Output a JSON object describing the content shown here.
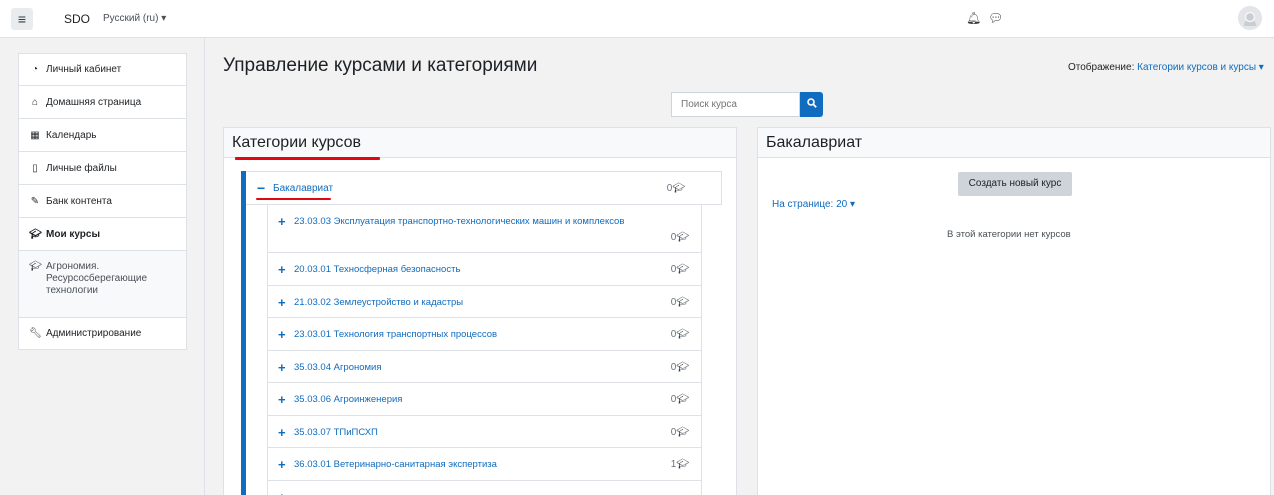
{
  "navbar": {
    "menu_icon": "hamburger-icon",
    "brand": "SDO",
    "language": "Русский (ru) ▾",
    "icons": [
      "bell-icon",
      "chat-icon",
      "avatar-icon"
    ]
  },
  "sidebar": {
    "items": [
      {
        "icon": "dashboard-icon",
        "label": "Личный кабинет"
      },
      {
        "icon": "home-icon",
        "label": "Домашняя страница"
      },
      {
        "icon": "calendar-icon",
        "label": "Календарь"
      },
      {
        "icon": "file-icon",
        "label": "Личные файлы"
      },
      {
        "icon": "paintbrush-icon",
        "label": "Банк контента"
      },
      {
        "icon": "graduation-cap-icon",
        "label": "Мои курсы"
      },
      {
        "icon": "graduation-cap-icon",
        "label": "Агрономия. Ресурсосберегающие технологии"
      }
    ],
    "admin": {
      "icon": "wrench-icon",
      "label": "Администрирование"
    }
  },
  "main": {
    "title": "Управление курсами и категориями",
    "display_label": "Отображение:",
    "display_value": "Категории курсов и курсы ▾",
    "search": {
      "placeholder": "Поиск курса",
      "button_icon": "search-icon"
    }
  },
  "categories_panel": {
    "title": "Категории курсов",
    "parent": {
      "name": "Бакалавриат",
      "count": "0"
    },
    "rows": [
      {
        "name": "23.03.03 Эксплуатация транспортно-технологических машин и комплексов",
        "count": "0"
      },
      {
        "name": "20.03.01 Техносферная безопасность",
        "count": "0"
      },
      {
        "name": "21.03.02 Землеустройство и кадастры",
        "count": "0"
      },
      {
        "name": "23.03.01 Технология транспортных процессов",
        "count": "0"
      },
      {
        "name": "35.03.04 Агрономия",
        "count": "0"
      },
      {
        "name": "35.03.06 Агроинженерия",
        "count": "0"
      },
      {
        "name": "35.03.07 ТПиПСХП",
        "count": "0"
      },
      {
        "name": "36.03.01 Ветеринарно-санитарная экспертиза",
        "count": "1"
      }
    ]
  },
  "courses_panel": {
    "title": "Бакалавриат",
    "create_button": "Создать новый курс",
    "per_page": "На странице: 20 ▾",
    "empty_message": "В этой категории нет курсов"
  },
  "colors": {
    "link": "#0f6cbf",
    "annotation_red": "#e30613"
  }
}
